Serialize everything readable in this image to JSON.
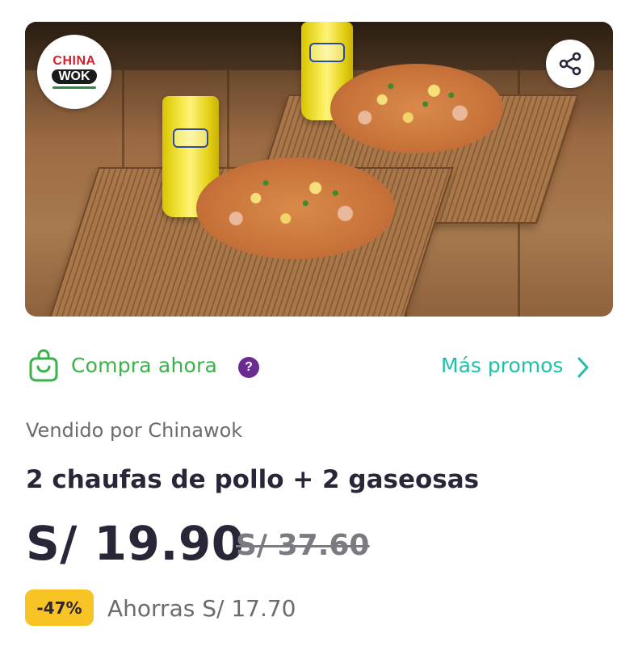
{
  "hero": {
    "image_alt": "2 chaufas de pollo con 2 vasos de Inca Kola sobre esteras de bambú",
    "brand_logo": {
      "line1": "CHINA",
      "line2": "WOK"
    },
    "share_icon": "share-icon"
  },
  "actions": {
    "buy_label": "Compra ahora",
    "help_glyph": "?",
    "more_promos_label": "Más promos",
    "icons": {
      "buy": "shopping-bag-icon",
      "help": "help-icon",
      "more": "chevron-right-icon"
    }
  },
  "product": {
    "seller": "Vendido por Chinawok",
    "title": "2 chaufas de pollo + 2 gaseosas",
    "price": "S/ 19.90",
    "old_price": "S/ 37.60",
    "discount": "-47%",
    "savings": "Ahorras S/ 17.70"
  },
  "colors": {
    "buy_green": "#3bb14a",
    "promo_teal": "#1fbfa8",
    "help_purple": "#6a2c91",
    "badge_yellow": "#f7c325",
    "text_dark": "#2a2638",
    "text_muted": "#6b6b6b"
  }
}
